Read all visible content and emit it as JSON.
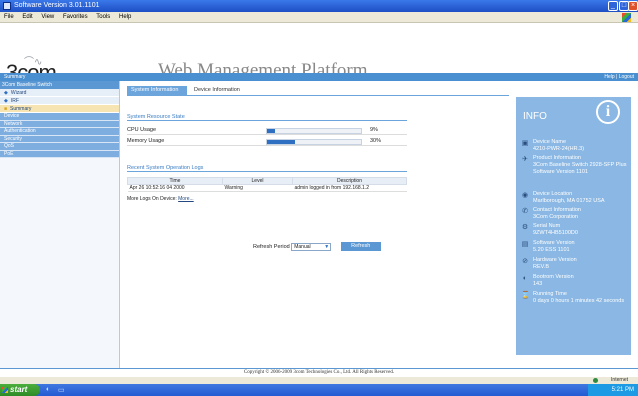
{
  "window": {
    "title": "Software Version 3.01.1101",
    "menu": [
      "File",
      "Edit",
      "View",
      "Favorites",
      "Tools",
      "Help"
    ]
  },
  "banner": {
    "logo": "3com",
    "title": "Web Management Platform"
  },
  "nav": {
    "left": "Summary",
    "right": "Help | Logout"
  },
  "sidebar": {
    "header": "3Com Baseline Switch",
    "tree": [
      {
        "label": "Wizard",
        "selected": false
      },
      {
        "label": "IRF",
        "selected": false
      },
      {
        "label": "Summary",
        "selected": true
      }
    ],
    "items": [
      "Device",
      "Network",
      "Authentication",
      "Security",
      "QoS",
      "PoE"
    ]
  },
  "tabs": {
    "active": "System Information",
    "other": "Device Information"
  },
  "resources": {
    "title": "System Resource State",
    "rows": [
      {
        "label": "CPU Usage",
        "value": "9%",
        "fill": 0.09
      },
      {
        "label": "Memory Usage",
        "value": "30%",
        "fill": 0.3
      }
    ]
  },
  "logs": {
    "title": "Recent System Operation Logs",
    "columns": [
      "Time",
      "Level",
      "Description"
    ],
    "rows": [
      [
        "Apr 26 10:52:16 04 2000",
        "Warning",
        "admin logged in from 192.168.1.2"
      ]
    ],
    "more_prefix": "More Logs On Device:",
    "more_link": "More..."
  },
  "refresh": {
    "label": "Refresh Period",
    "selected": "Manual",
    "button": "Refresh"
  },
  "info": {
    "title": "INFO",
    "items": [
      {
        "icon": "device-name-icon",
        "glyph": "▣",
        "label": "Device Name",
        "value": "4210-PWR-24(HR.3)"
      },
      {
        "icon": "product-info-icon",
        "glyph": "✈",
        "label": "Product Information",
        "value": "3Com Baseline Switch 2928-SFP Plus Software Version 1101"
      },
      {
        "icon": "device-location-icon",
        "glyph": "◉",
        "label": "Device Location",
        "value": "Marlborough, MA 01752 USA"
      },
      {
        "icon": "contact-info-icon",
        "glyph": "✆",
        "label": "Contact Information",
        "value": "3Com Corporation"
      },
      {
        "icon": "serial-number-icon",
        "glyph": "⚙",
        "label": "Serial Num",
        "value": "9ZWT4HB5100D0"
      },
      {
        "icon": "software-version-icon",
        "glyph": "▤",
        "label": "Software Version",
        "value": "5.20 ESS 1101"
      },
      {
        "icon": "hardware-version-icon",
        "glyph": "⊘",
        "label": "Hardware Version",
        "value": "REV.B"
      },
      {
        "icon": "bootrom-version-icon",
        "glyph": "◐",
        "label": "Bootrom Version",
        "value": "143"
      },
      {
        "icon": "running-time-icon",
        "glyph": "⌛",
        "label": "Running Time",
        "value": "0 days 0 hours 1 minutes 42 seconds"
      }
    ]
  },
  "footer": "Copyright © 2006-2009 3com Technologies Co., Ltd. All Rights Reserved.",
  "statusbar": {
    "zone": "Internet"
  },
  "taskbar": {
    "start": "start",
    "clock": "5:21 PM"
  }
}
